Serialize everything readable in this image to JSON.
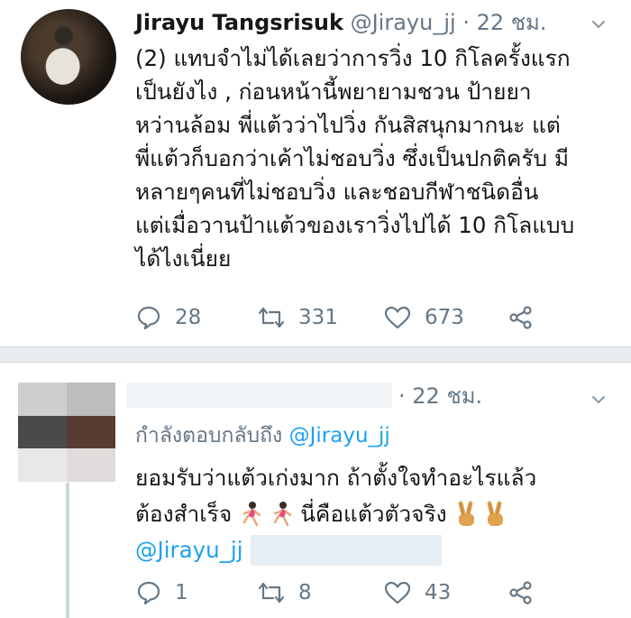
{
  "tweet1": {
    "author_name": "Jirayu Tangsrisuk",
    "handle": "@Jirayu_jj",
    "separator": "·",
    "time": "22 ชม.",
    "body_lines": [
      "(2) แทบจำไม่ได้เลยว่าการวิ่ง 10 กิโลครั้งแรก",
      "เป็นยังไง , ก่อนหน้านี้พยายามชวน ป้ายยา",
      "หว่านล้อม พี่แต้วว่าไปวิ่ง กันสิสนุกมากนะ แต่",
      "พี่แต้วก็บอกว่าเค้าไม่ชอบวิ่ง ซึ่งเป็นปกติครับ มี",
      "หลายๆคนที่ไม่ชอบวิ่ง และชอบกีฬาชนิดอื่น",
      "แต่เมื่อวานป้าแต้วของเราวิ่งไปได้ 10 กิโลแบบ",
      "ได้ไงเนี่ยย"
    ],
    "reply_count": "28",
    "retweet_count": "331",
    "like_count": "673"
  },
  "tweet2": {
    "separator": "·",
    "time": "22 ชม.",
    "replying_to_label": "กำลังตอบกลับถึง",
    "replying_to_handle": "@Jirayu_jj",
    "body_line1": "ยอมรับว่าแต้วเก่งมาก ถ้าตั้งใจทำอะไรแล้ว",
    "body_line2_part1": "ต้องสำเร็จ",
    "body_line2_part2": "นี่คือแต้วตัวจริง",
    "mention": "@Jirayu_jj",
    "reply_count": "1",
    "retweet_count": "8",
    "like_count": "43"
  },
  "icons": {
    "reply": "reply-icon",
    "retweet": "retweet-icon",
    "like": "heart-icon",
    "share": "share-icon",
    "more": "chevron-down-icon",
    "runner": "running-woman-emoji",
    "victory": "victory-hand-emoji"
  },
  "colors": {
    "link": "#1da1f2",
    "muted": "#657786",
    "text": "#14171a",
    "separator": "#e6ecf0"
  }
}
